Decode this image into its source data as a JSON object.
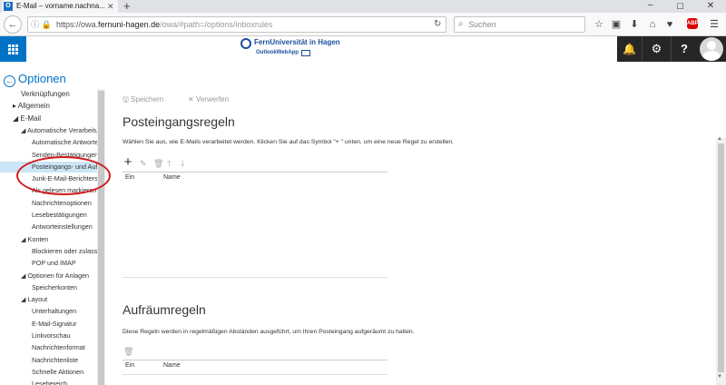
{
  "browser": {
    "tab_title": "E-Mail – vorname.nachna...",
    "tab_icon_text": "O",
    "url_prefix": "https://owa.",
    "url_domain": "fernuni-hagen.de",
    "url_path": "/owa/#path=/options/inboxrules",
    "search_placeholder": "Suchen"
  },
  "owa_header": {
    "logo_title": "FernUniversität in Hagen",
    "logo_subtitle": "OutlookWebApp"
  },
  "options": {
    "back_label": "Optionen"
  },
  "nav": {
    "items": [
      {
        "label": "Verknüpfungen",
        "level": "l0"
      },
      {
        "label": "▸ Allgemein",
        "level": "l0a"
      },
      {
        "label": "◢ E-Mail",
        "level": "l0a"
      },
      {
        "label": "◢ Automatische Verarbeitung",
        "level": "l1"
      },
      {
        "label": "Automatische Antworten",
        "level": "l2"
      },
      {
        "label": "Senden-Bestätigungen",
        "level": "l2"
      },
      {
        "label": "Posteingangs- und Aufräumregeln",
        "level": "l2",
        "selected": true
      },
      {
        "label": "Junk-E-Mail-Berichterstattung",
        "level": "l2"
      },
      {
        "label": "Als gelesen markieren",
        "level": "l2"
      },
      {
        "label": "Nachrichtenoptionen",
        "level": "l2"
      },
      {
        "label": "Lesebestätigungen",
        "level": "l2"
      },
      {
        "label": "Antworteinstellungen",
        "level": "l2"
      },
      {
        "label": "◢ Konten",
        "level": "l1"
      },
      {
        "label": "Blockieren oder zulassen",
        "level": "l2"
      },
      {
        "label": "POP und IMAP",
        "level": "l2"
      },
      {
        "label": "◢ Optionen für Anlagen",
        "level": "l1"
      },
      {
        "label": "Speicherkonten",
        "level": "l2"
      },
      {
        "label": "◢ Layout",
        "level": "l1"
      },
      {
        "label": "Unterhaltungen",
        "level": "l2"
      },
      {
        "label": "E-Mail-Signatur",
        "level": "l2"
      },
      {
        "label": "Linkvorschau",
        "level": "l2"
      },
      {
        "label": "Nachrichtenformat",
        "level": "l2"
      },
      {
        "label": "Nachrichtenliste",
        "level": "l2"
      },
      {
        "label": "Schnelle Aktionen",
        "level": "l2"
      },
      {
        "label": "Lesebereich",
        "level": "l2"
      }
    ]
  },
  "toolbar": {
    "save_label": "Speichern",
    "discard_label": "Verwerfen"
  },
  "inbox_rules": {
    "title": "Posteingangsregeln",
    "description": "Wählen Sie aus, wie E-Mails verarbeitet werden. Klicken Sie auf das Symbol \"+ \" unten, um eine neue Regel zu erstellen.",
    "col_on": "Ein",
    "col_name": "Name"
  },
  "cleanup_rules": {
    "title": "Aufräumregeln",
    "description": "Diese Regeln werden in regelmäßigen Abständen ausgeführt, um Ihren Posteingang aufgeräumt zu halten.",
    "col_on": "Ein",
    "col_name": "Name"
  },
  "colors": {
    "accent": "#0072c6",
    "header_dark": "#262626",
    "highlight_circle": "#d21a1a",
    "selected_nav": "#cde6f7"
  }
}
